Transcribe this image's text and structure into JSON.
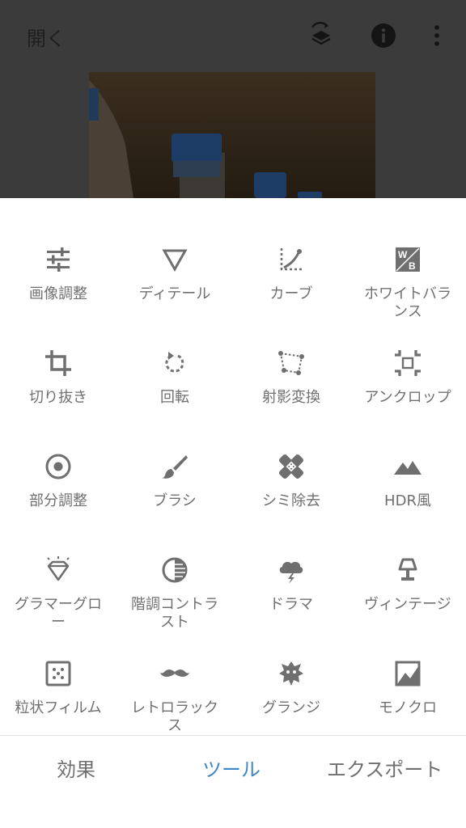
{
  "header": {
    "open_label": "開く"
  },
  "tools": [
    {
      "label": "画像調整",
      "icon": "tune-sliders-icon"
    },
    {
      "label": "ディテール",
      "icon": "triangle-down-icon"
    },
    {
      "label": "カーブ",
      "icon": "curve-icon"
    },
    {
      "label": "ホワイトバランス",
      "icon": "white-balance-icon"
    },
    {
      "label": "切り抜き",
      "icon": "crop-icon"
    },
    {
      "label": "回転",
      "icon": "rotate-icon"
    },
    {
      "label": "射影変換",
      "icon": "perspective-icon"
    },
    {
      "label": "アンクロップ",
      "icon": "expand-crop-icon"
    },
    {
      "label": "部分調整",
      "icon": "target-icon"
    },
    {
      "label": "ブラシ",
      "icon": "brush-icon"
    },
    {
      "label": "シミ除去",
      "icon": "healing-bandage-icon"
    },
    {
      "label": "HDR風",
      "icon": "mountains-icon"
    },
    {
      "label": "グラマーグロー",
      "icon": "diamond-icon"
    },
    {
      "label": "階調コントラスト",
      "icon": "contrast-icon"
    },
    {
      "label": "ドラマ",
      "icon": "storm-cloud-icon"
    },
    {
      "label": "ヴィンテージ",
      "icon": "lamp-icon"
    },
    {
      "label": "粒状フィルム",
      "icon": "film-grain-icon"
    },
    {
      "label": "レトロラックス",
      "icon": "mustache-icon"
    },
    {
      "label": "グランジ",
      "icon": "grunge-icon"
    },
    {
      "label": "モノクロ",
      "icon": "monochrome-icon"
    }
  ],
  "tabs": {
    "effects": "効果",
    "tools": "ツール",
    "export": "エクスポート",
    "active": "ツール"
  },
  "colors": {
    "active_tab": "#3f86c8",
    "icon": "#6f6f6f",
    "text": "#6f6f6f"
  }
}
